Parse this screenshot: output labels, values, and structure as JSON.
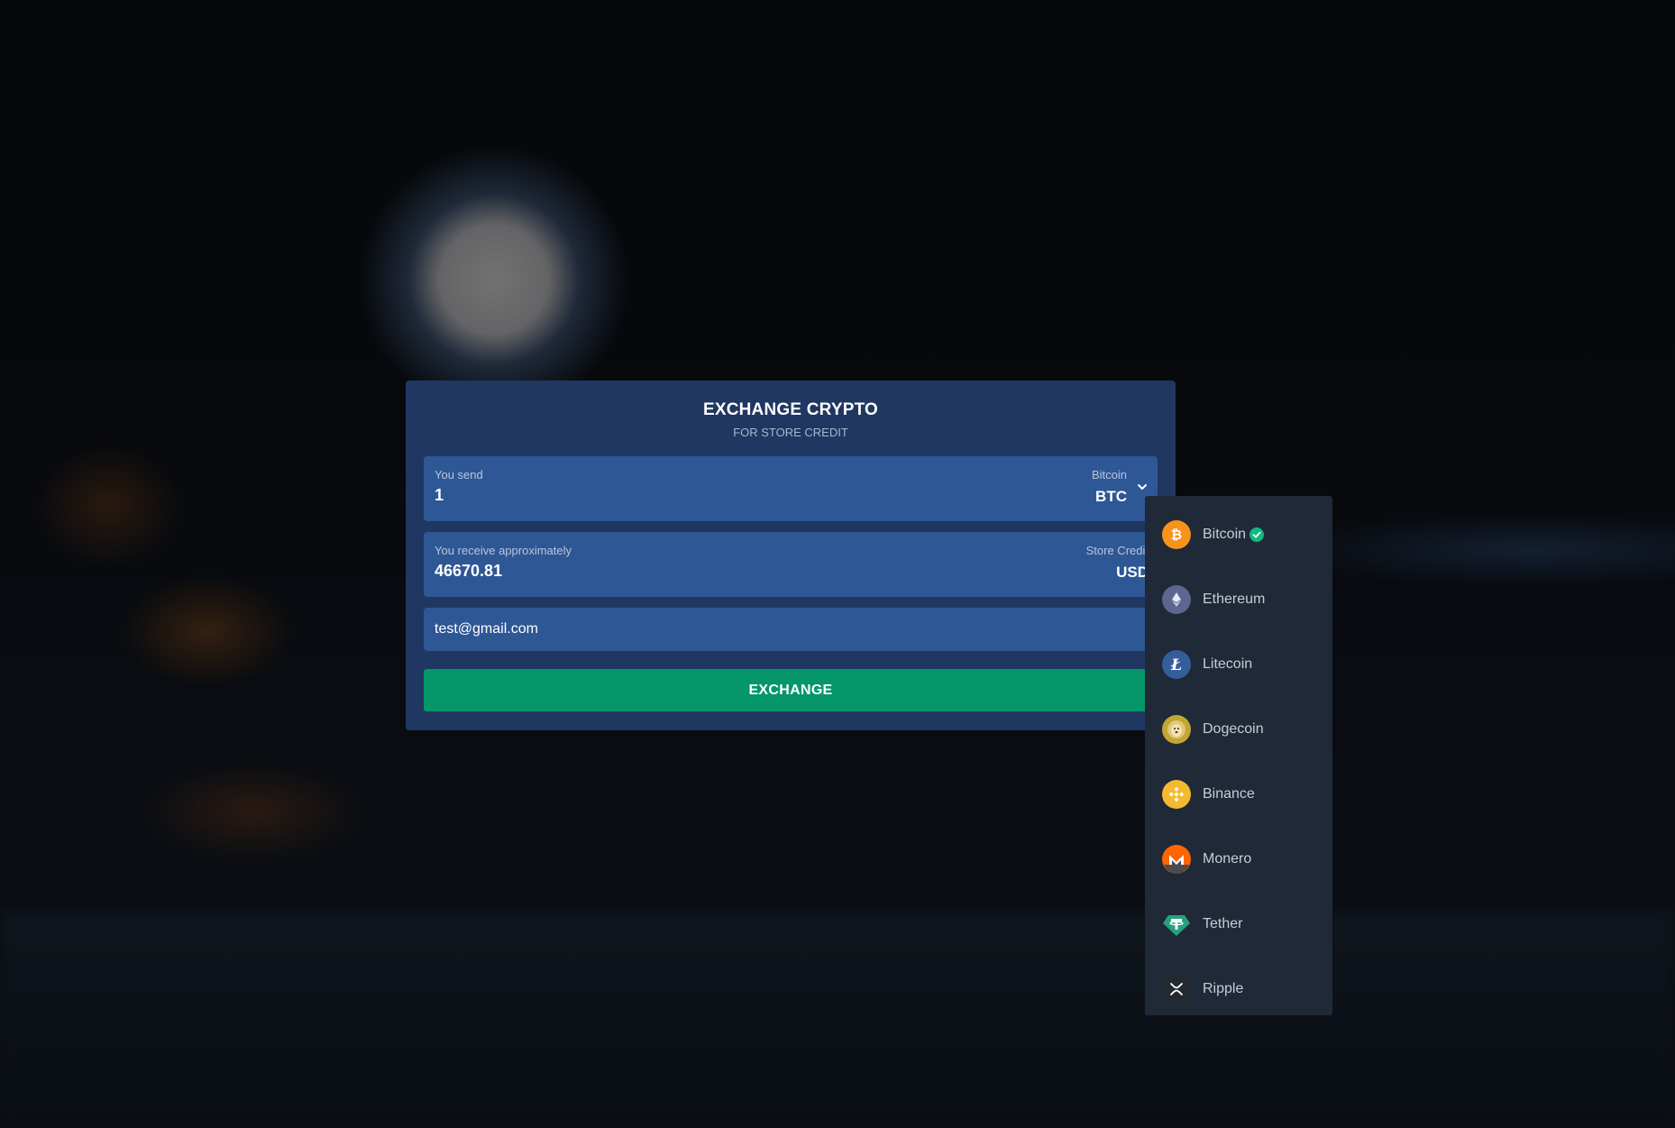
{
  "header": {
    "title": "EXCHANGE CRYPTO",
    "subtitle": "FOR STORE CREDIT"
  },
  "send": {
    "label": "You send",
    "value": "1",
    "currency_name": "Bitcoin",
    "currency_code": "BTC"
  },
  "receive": {
    "label": "You receive approximately",
    "value": "46670.81",
    "currency_name": "Store Credit",
    "currency_code": "USD"
  },
  "email": {
    "value": "test@gmail.com"
  },
  "exchange_button": {
    "label": "EXCHANGE"
  },
  "colors": {
    "card_bg": "#1f3761",
    "field_bg": "#2e5795",
    "button_bg": "#059669",
    "dropdown_bg": "#1f2937",
    "selected_check": "#10b981"
  },
  "dropdown": {
    "selected": "Bitcoin",
    "items": [
      {
        "label": "Bitcoin",
        "icon": "bitcoin-icon",
        "color": "#f7931a",
        "selected": true
      },
      {
        "label": "Ethereum",
        "icon": "ethereum-icon",
        "color": "#627eea",
        "selected": false
      },
      {
        "label": "Litecoin",
        "icon": "litecoin-icon",
        "color": "#345d9d",
        "selected": false
      },
      {
        "label": "Dogecoin",
        "icon": "dogecoin-icon",
        "color": "#c2a633",
        "selected": false
      },
      {
        "label": "Binance",
        "icon": "binance-icon",
        "color": "#f3ba2f",
        "selected": false
      },
      {
        "label": "Monero",
        "icon": "monero-icon",
        "color": "#ff6600",
        "selected": false
      },
      {
        "label": "Tether",
        "icon": "tether-icon",
        "color": "#26a17b",
        "selected": false
      },
      {
        "label": "Ripple",
        "icon": "ripple-icon",
        "color": "#23292f",
        "selected": false
      }
    ]
  }
}
